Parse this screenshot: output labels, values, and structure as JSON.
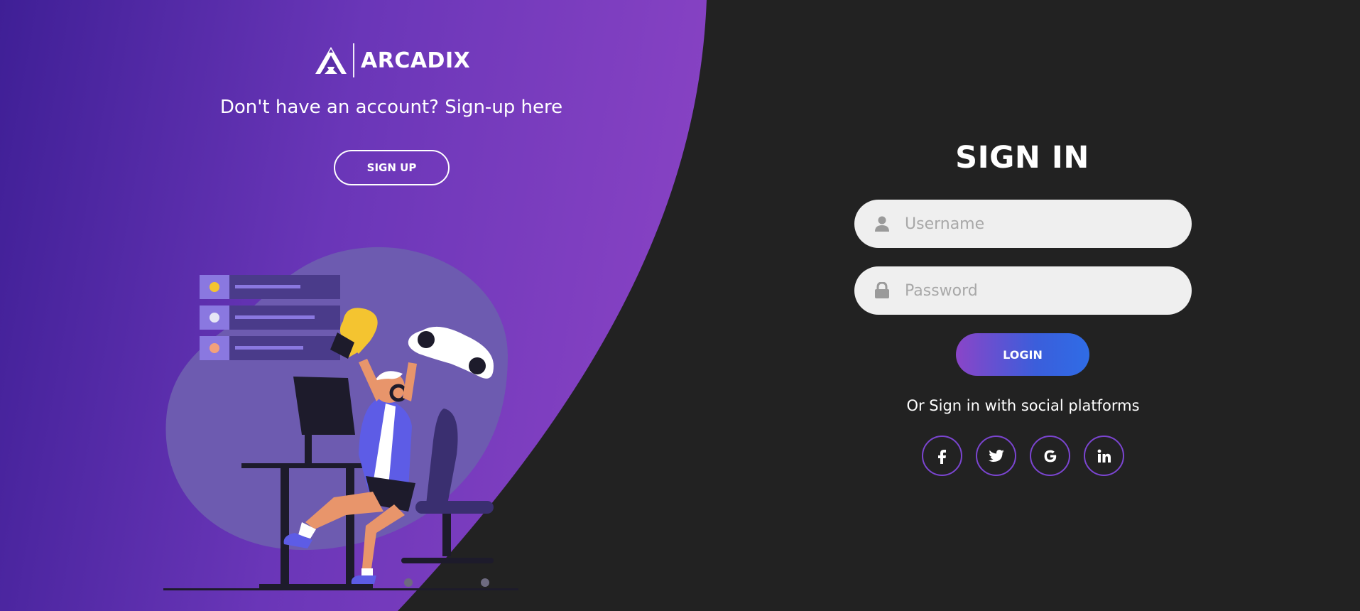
{
  "brand": {
    "name": "ARCADIX"
  },
  "left_panel": {
    "signup_prompt": "Don't have an account? Sign-up here",
    "signup_button": "SIGN UP"
  },
  "signin": {
    "title": "SIGN IN",
    "username": {
      "placeholder": "Username",
      "value": "",
      "icon": "user-icon"
    },
    "password": {
      "placeholder": "Password",
      "value": "",
      "icon": "lock-icon"
    },
    "login_button": "LOGIN",
    "social_prompt": "Or Sign in with social platforms",
    "social": [
      "facebook-icon",
      "twitter-icon",
      "google-icon",
      "linkedin-icon"
    ]
  },
  "colors": {
    "background": "#222222",
    "purple_start": "#3f1f96",
    "purple_end": "#8e45c6",
    "social_border": "#7b45d1",
    "login_gradient_start": "#8a45c8",
    "login_gradient_end": "#2f6ce6"
  }
}
